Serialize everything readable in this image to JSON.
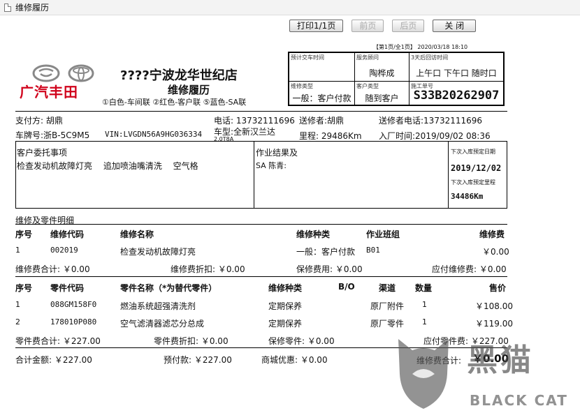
{
  "window": {
    "title": "维修履历"
  },
  "toolbar": {
    "print": "打印1/1页",
    "prev": "前页",
    "next": "后页",
    "close": "关 闭"
  },
  "page_info": "【第1页/全1页】 2020/03/18 18:10",
  "brand": {
    "logo_text": "广汽丰田"
  },
  "store": {
    "name": "????宁波龙华世纪店",
    "doc_title": "维修履历",
    "copies": "①白色-车间联 ②红色-客户联 ⑤蓝色-SA联"
  },
  "header_box": {
    "r1": {
      "l1": "预计交车时间",
      "v1": "",
      "l2": "服务顾问",
      "v2": "陶桦成",
      "l3": "3天后回访时间",
      "v3": "上午口 下午口 随时口"
    },
    "r2": {
      "l1": "维修类型",
      "v1": "一般：客户付款",
      "l2": "客户类型",
      "v2": "随到客户",
      "l3": "施工单号",
      "v3": "S33B20262907"
    }
  },
  "info": {
    "payer": "支付方: 胡鼎",
    "phone": "电话: 13732111696",
    "sender": "送修者:胡鼎",
    "sender_phone": "送修者电话:13732111696",
    "plate": "车牌号:浙B-5C9M5",
    "vin": "VIN:LVGDN56A9HG036334",
    "model": "车型:全新汉兰达",
    "model_sub": "2.0T8A",
    "mileage": "里程: 29486Km",
    "entry_time": "入厂时间:2019/09/02 08:36"
  },
  "request": {
    "label": "客户委托事项",
    "items": "检查发动机故障灯亮　 追加喷油嘴清洗　 空气格",
    "result_label": "作业结果及",
    "result_sa": "SA 陈青:",
    "next_date_label": "下次入库预定日期",
    "next_date": "2019/12/02",
    "next_mileage_label": "下次入库预定里程",
    "next_mileage": "34486Km"
  },
  "section_title": "维修及零件明细",
  "labor": {
    "headers": [
      "序号",
      "维修代码",
      "维修名称",
      "维修种类",
      "作业班组",
      "维修费"
    ],
    "rows": [
      [
        "1",
        "002019",
        "检查发动机故障灯亮",
        "一般：客户付款",
        "B01",
        "￥0.00"
      ]
    ],
    "sum_label": "维修费合计: ￥0.00",
    "discount_label": "维修费折扣: ￥0.00",
    "warranty_label": "保修费用: ￥0.00",
    "payable_label": "应付维修费: ￥0.00"
  },
  "parts": {
    "headers": [
      "序号",
      "零件代码",
      "零件名称（*为替代零件）",
      "维修种类",
      "B/O",
      "渠道",
      "数量",
      "售价"
    ],
    "rows": [
      [
        "1",
        "088GM158F0",
        "燃油系统超强清洗剂",
        "定期保养",
        "",
        "原厂附件",
        "1",
        "￥108.00"
      ],
      [
        "2",
        "178010P080",
        "空气滤清器滤芯分总成",
        "定期保养",
        "",
        "原厂零件",
        "1",
        "￥119.00"
      ]
    ],
    "sum_label": "零件费合计: ￥227.00",
    "discount_label": "零件费折扣: ￥0.00",
    "warranty_label": "保修零件: ￥0.00",
    "payable_label": "应付零件费: ￥227.00"
  },
  "totals": {
    "total": "合计金额: ￥227.00",
    "prepay": "预付款: ￥227.00",
    "mall_discount": "商城优惠: ￥0.00",
    "labor_total": "维修费合计:",
    "labor_total_value": "￥0.00"
  },
  "watermark": {
    "cn": "黑猫",
    "en": "BLACK CAT"
  }
}
